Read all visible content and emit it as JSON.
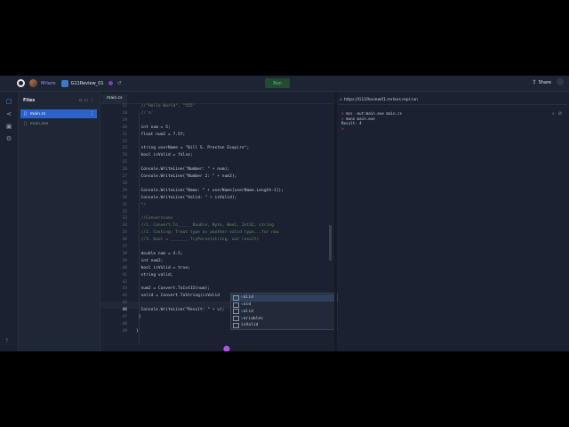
{
  "topbar": {
    "user": "Mrlans",
    "repl_name": "G11Review_01",
    "run_label": "Run",
    "share_label": "Share"
  },
  "files_panel": {
    "title": "Files",
    "items": [
      {
        "name": "main.cs"
      },
      {
        "name": "main.exe"
      }
    ]
  },
  "editor": {
    "tab": "main.cs",
    "lines": [
      {
        "num": "17",
        "text": "  //\"Hello World\", \"555\"",
        "cls": "cm"
      },
      {
        "num": "18",
        "text": "  //'a'",
        "cls": "cm"
      },
      {
        "num": "19",
        "text": "",
        "cls": ""
      },
      {
        "num": "20",
        "text": "  int num = 5;",
        "cls": ""
      },
      {
        "num": "21",
        "text": "  float num2 = 7.5f;",
        "cls": ""
      },
      {
        "num": "22",
        "text": "",
        "cls": ""
      },
      {
        "num": "23",
        "text": "  string userName = \"Bill S. Preston Esquire\";",
        "cls": ""
      },
      {
        "num": "24",
        "text": "  bool isValid = false;",
        "cls": ""
      },
      {
        "num": "25",
        "text": "",
        "cls": ""
      },
      {
        "num": "26",
        "text": "  Console.WriteLine(\"Number: \" + num);",
        "cls": ""
      },
      {
        "num": "27",
        "text": "  Console.WriteLine(\"Number 2: \" + num2);",
        "cls": ""
      },
      {
        "num": "28",
        "text": "",
        "cls": ""
      },
      {
        "num": "29",
        "text": "  Console.WriteLine(\"Name: \" + userName[userName.Length-1]);",
        "cls": ""
      },
      {
        "num": "30",
        "text": "  Console.WriteLine(\"Valid: \" + isValid);",
        "cls": ""
      },
      {
        "num": "31",
        "text": "  */",
        "cls": "cm"
      },
      {
        "num": "32",
        "text": "",
        "cls": ""
      },
      {
        "num": "33",
        "text": "  //Conversions",
        "cls": "cm"
      },
      {
        "num": "34",
        "text": "  //1. Convert.To_____ Double, Byte, Bool, Int32, string",
        "cls": "cm"
      },
      {
        "num": "35",
        "text": "  //2. Casting: Treat type as another valid type...for now",
        "cls": "cm"
      },
      {
        "num": "36",
        "text": "  //3. bool = _______.TryParse(string, out result)",
        "cls": "cm"
      },
      {
        "num": "37",
        "text": "",
        "cls": ""
      },
      {
        "num": "38",
        "text": "  double num = 4.5;",
        "cls": ""
      },
      {
        "num": "39",
        "text": "  int num2;",
        "cls": ""
      },
      {
        "num": "40",
        "text": "  bool isValid = true;",
        "cls": ""
      },
      {
        "num": "41",
        "text": "  string valid;",
        "cls": ""
      },
      {
        "num": "42",
        "text": "",
        "cls": ""
      },
      {
        "num": "43",
        "text": "  num2 = Convert.ToInt32(num);",
        "cls": ""
      },
      {
        "num": "44",
        "text": "  valid = Convert.ToString(isValid",
        "cls": ""
      },
      {
        "num": "45",
        "text": "",
        "cls": ""
      },
      {
        "num": "46",
        "text": "  Console.WriteLine(\"Result: \" + v);",
        "cls": ""
      },
      {
        "num": "47",
        "text": " }",
        "cls": ""
      },
      {
        "num": "48",
        "text": "",
        "cls": ""
      },
      {
        "num": "49",
        "text": "}",
        "cls": ""
      }
    ]
  },
  "autocomplete": {
    "items": [
      {
        "match": "v",
        "rest": "alid"
      },
      {
        "match": "v",
        "rest": "oid"
      },
      {
        "match": "v",
        "rest": "alid"
      },
      {
        "match": "v",
        "rest": "ariables"
      },
      {
        "match": "",
        "rest": "isValid"
      }
    ]
  },
  "console": {
    "url": "https://G11Review01.mrlans.repl.run",
    "lines": [
      {
        "prompt": ">",
        "text": " mcs -out:main.exe main.cs"
      },
      {
        "prompt": ">",
        "text": " mono main.exe"
      },
      {
        "prompt": "",
        "text": "Result: 4"
      },
      {
        "prompt": ">",
        "text": ""
      }
    ]
  }
}
